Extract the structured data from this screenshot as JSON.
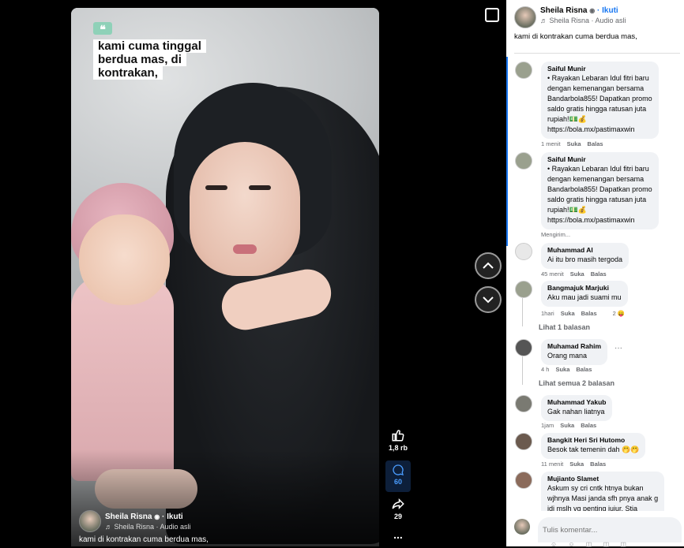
{
  "video": {
    "caption_lines": [
      "kami cuma tinggal",
      "berdua mas, di",
      "kontrakan,"
    ],
    "quote_glyph": "❝",
    "author": "Sheila Risna",
    "follow": "· Ikuti",
    "audio": "♬ Sheila Risna · Audio asli",
    "description": "kami di kontrakan cuma berdua mas,"
  },
  "rail": {
    "likes": "1,8 rb",
    "comments": "60",
    "shares": "29",
    "more": "..."
  },
  "panel": {
    "author": "Sheila Risna",
    "follow": "· Ikuti",
    "audio": "♬ Sheila Risna · Audio asli",
    "caption": "kami di kontrakan cuma berdua mas,",
    "comment_placeholder": "Tulis komentar..."
  },
  "comments": [
    {
      "name": "Saiful Munir",
      "text": "• Rayakan Lebaran Idul fitri baru\ndengan kemenangan bersama\nBandarbola855! Dapatkan promo\nsaldo gratis hingga ratusan juta\nrupiah!💵💰\nhttps://bola.mx/pastimaxwin",
      "time": "1 menit",
      "like": "Suka",
      "reply": "Balas"
    },
    {
      "name": "Saiful Munir",
      "text": "• Rayakan Lebaran Idul fitri baru\ndengan kemenangan bersama\nBandarbola855! Dapatkan promo\nsaldo gratis hingga ratusan juta\nrupiah!💵💰\nhttps://bola.mx/pastimaxwin",
      "time": "Mengirim...",
      "like": "",
      "reply": ""
    },
    {
      "name": "Muhammad Al",
      "text": "Ai itu bro masih tergoda",
      "time": "45 menit",
      "like": "Suka",
      "reply": "Balas"
    },
    {
      "name": "Bangmajuk Marjuki",
      "text": "Aku mau jadi suami mu",
      "time": "1hari",
      "like": "Suka",
      "reply": "Balas",
      "reactions": "2 😛",
      "view_replies": "Lihat 1 balasan"
    },
    {
      "name": "Muhamad Rahim",
      "text": "Orang mana",
      "time": "4 h",
      "like": "Suka",
      "reply": "Balas",
      "more": "···",
      "view_replies": "Lihat semua 2 balasan"
    },
    {
      "name": "Muhammad Yakub",
      "text": "Gak nahan liatnya",
      "time": "1jam",
      "like": "Suka",
      "reply": "Balas"
    },
    {
      "name": "Bangkit Heri Sri Hutomo",
      "text": "Besok tak temenin dah 🤭🤭",
      "time": "11 menit",
      "like": "Suka",
      "reply": "Balas"
    },
    {
      "name": "Mujianto Slamet",
      "text": "Askum sy cri cntk htnya bukan\nwjhnya Masi janda sfh pnya anak g\nidi mslh vg penting jujur. Stia",
      "time": "",
      "like": "",
      "reply": ""
    }
  ],
  "icons": [
    "quote-icon",
    "like-icon",
    "comment-icon",
    "share-icon",
    "more-icon",
    "chevron-up-icon",
    "chevron-down-icon",
    "sidebar-toggle-icon",
    "globe-icon",
    "music-note-icon"
  ]
}
